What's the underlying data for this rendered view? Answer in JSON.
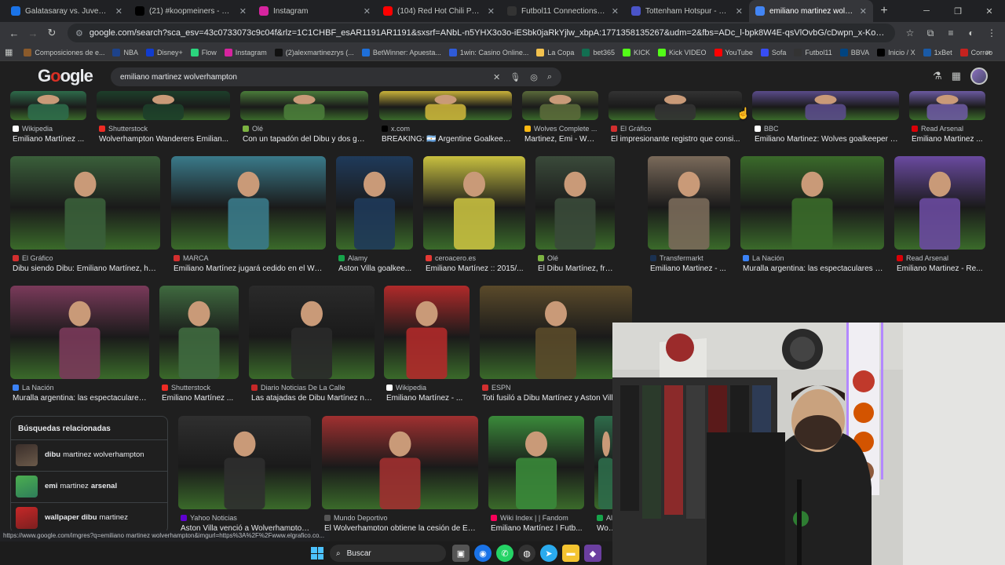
{
  "tabs": [
    {
      "title": "Galatasaray vs. Juventus | Disne",
      "color": "#1a73e8",
      "icon": "globe-icon"
    },
    {
      "title": "(21) #koopmeiners - Buscar / X",
      "color": "#000000",
      "icon": "x-icon"
    },
    {
      "title": "Instagram",
      "color": "#d6249f",
      "icon": "instagram-icon"
    },
    {
      "title": "(104) Red Hot Chili Pepper",
      "color": "#ff0000",
      "icon": "youtube-icon"
    },
    {
      "title": "Futbol11 Connections - Play Fo",
      "color": "#333333",
      "icon": "futbol11-icon"
    },
    {
      "title": "Tottenham Hotspur - Manchest",
      "color": "#4a54c8",
      "icon": "globe-icon"
    },
    {
      "title": "emiliano martinez wolverhamp",
      "color": "#4285f4",
      "icon": "google-icon"
    }
  ],
  "url": "google.com/search?sca_esv=43c0733073c9c04f&rlz=1C1CHBF_esAR1191AR1191&sxsrf=ANbL-n5YHX3o3o-iESbk0jaRkYjlw_xbpA:1771358135267&udm=2&fbs=ADc_l-bpk8W4E-qsVlOvbG/cDwpn_x-KoZgS_dlzvUJcCpPvNisF2DcSRPJpJfBfbNP3o4JLH...",
  "bookmarks": [
    {
      "label": "Composiciones de e...",
      "color": "#8a5a2b"
    },
    {
      "label": "NBA",
      "color": "#1d428a"
    },
    {
      "label": "Disney+",
      "color": "#113ccf"
    },
    {
      "label": "Flow",
      "color": "#2bd47d"
    },
    {
      "label": "Instagram",
      "color": "#d6249f"
    },
    {
      "label": "(2)alexmartinezrys (...",
      "color": "#111111"
    },
    {
      "label": "BetWinner: Apuesta...",
      "color": "#1e6fd9"
    },
    {
      "label": "1win: Casino Online...",
      "color": "#2f5bd9"
    },
    {
      "label": "La Copa",
      "color": "#f2c14e"
    },
    {
      "label": "bet365",
      "color": "#126e51"
    },
    {
      "label": "KICK",
      "color": "#53fc18"
    },
    {
      "label": "Kick VIDEO",
      "color": "#53fc18"
    },
    {
      "label": "YouTube",
      "color": "#ff0000"
    },
    {
      "label": "Sofa",
      "color": "#374df5"
    },
    {
      "label": "Futbol11",
      "color": "#333333"
    },
    {
      "label": "BBVA",
      "color": "#004481"
    },
    {
      "label": "Inicio / X",
      "color": "#000000"
    },
    {
      "label": "1xBet",
      "color": "#1a5aa6"
    },
    {
      "label": "Correo",
      "color": "#c5221f"
    }
  ],
  "search": {
    "query": "emiliano martinez wolverhampton",
    "logo": "Google"
  },
  "row0": [
    {
      "source": "Wikipedia",
      "caption": "Emiliano Martínez ...",
      "scolor": "#ffffff"
    },
    {
      "source": "Shutterstock",
      "caption": "Wolverhampton Wanderers Emilian...",
      "scolor": "#ee2b24"
    },
    {
      "source": "Olé",
      "caption": "Con un tapadón del Dibu y dos gol...",
      "scolor": "#7cb342"
    },
    {
      "source": "x.com",
      "caption": "BREAKING: 🇦🇷 Argentine Goalkeep...",
      "scolor": "#000000"
    },
    {
      "source": "Wolves Complete ...",
      "caption": "Martinez, Emi - Wo...",
      "scolor": "#fdb913"
    },
    {
      "source": "El Gráfico",
      "caption": "El impresionante registro que consi...",
      "scolor": "#d32f2f"
    },
    {
      "source": "BBC",
      "caption": "Emiliano Martinez: Wolves goalkeeper o...",
      "scolor": "#ffffff"
    },
    {
      "source": "Read Arsenal",
      "caption": "Emiliano Martinez ...",
      "scolor": "#db0007"
    }
  ],
  "row1": [
    {
      "source": "El Gráfico",
      "caption": "Dibu siendo Dibu: Emiliano Martínez, hér...",
      "scolor": "#d32f2f"
    },
    {
      "source": "MARCA",
      "caption": "Emiliano Martínez jugará cedido en el Wol...",
      "scolor": "#d32f2f"
    },
    {
      "source": "Alamy",
      "caption": "Aston Villa goalkee...",
      "scolor": "#16a34a"
    },
    {
      "source": "ceroacero.es",
      "caption": "Emiliano Martínez :: 2015/...",
      "scolor": "#e53935"
    },
    {
      "source": "Olé",
      "caption": "El Dibu Martínez, frustrado...",
      "scolor": "#7cb342"
    },
    {
      "source": "Transfermarkt",
      "caption": "Emiliano Martinez - ...",
      "scolor": "#1a3151"
    },
    {
      "source": "La Nación",
      "caption": "Muralla argentina: las espectaculares a...",
      "scolor": "#3b82f6"
    },
    {
      "source": "Read Arsenal",
      "caption": "Emiliano Martinez - Re...",
      "scolor": "#db0007"
    }
  ],
  "row2": [
    {
      "source": "La Nación",
      "caption": "Muralla argentina: las espectaculares...",
      "scolor": "#3b82f6"
    },
    {
      "source": "Shutterstock",
      "caption": "Emiliano Martínez ...",
      "scolor": "#ee2b24"
    },
    {
      "source": "Diario Noticias De La Calle",
      "caption": "Las atajadas de Dibu Martínez no...",
      "scolor": "#c62828"
    },
    {
      "source": "Wikipedia",
      "caption": "Emiliano Martínez - ...",
      "scolor": "#ffffff"
    },
    {
      "source": "ESPN",
      "caption": "Toti fusiló a Dibu Martínez y Aston Villa",
      "scolor": "#d32f2f"
    }
  ],
  "row3": [
    {
      "source": "Yahoo Noticias",
      "caption": "Aston Villa venció a Wolverhampton...",
      "scolor": "#6001d2"
    },
    {
      "source": "Mundo Deportivo",
      "caption": "El Wolverhampton obtiene la cesión de Em...",
      "scolor": "#555555"
    },
    {
      "source": "Wiki Index | | Fandom",
      "caption": "Emiliano Martínez | Futb...",
      "scolor": "#fa005a"
    },
    {
      "source": "Ala",
      "caption": "Wolv...",
      "scolor": "#16a34a"
    }
  ],
  "related": {
    "title": "Búsquedas relacionadas",
    "items": [
      {
        "bold": "dibu",
        "rest": "martinez wolverhampton"
      },
      {
        "bold": "emi",
        "rest": "martinez",
        "bold2": "arsenal"
      },
      {
        "bold": "wallpaper dibu",
        "rest": "martinez"
      }
    ]
  },
  "status_url": "https://www.google.com/imgres?q=emiliano martinez wolverhampton&imgurl=https%3A%2F%2Fwww.elgrafico.co...",
  "taskbar": {
    "search": "Buscar"
  }
}
